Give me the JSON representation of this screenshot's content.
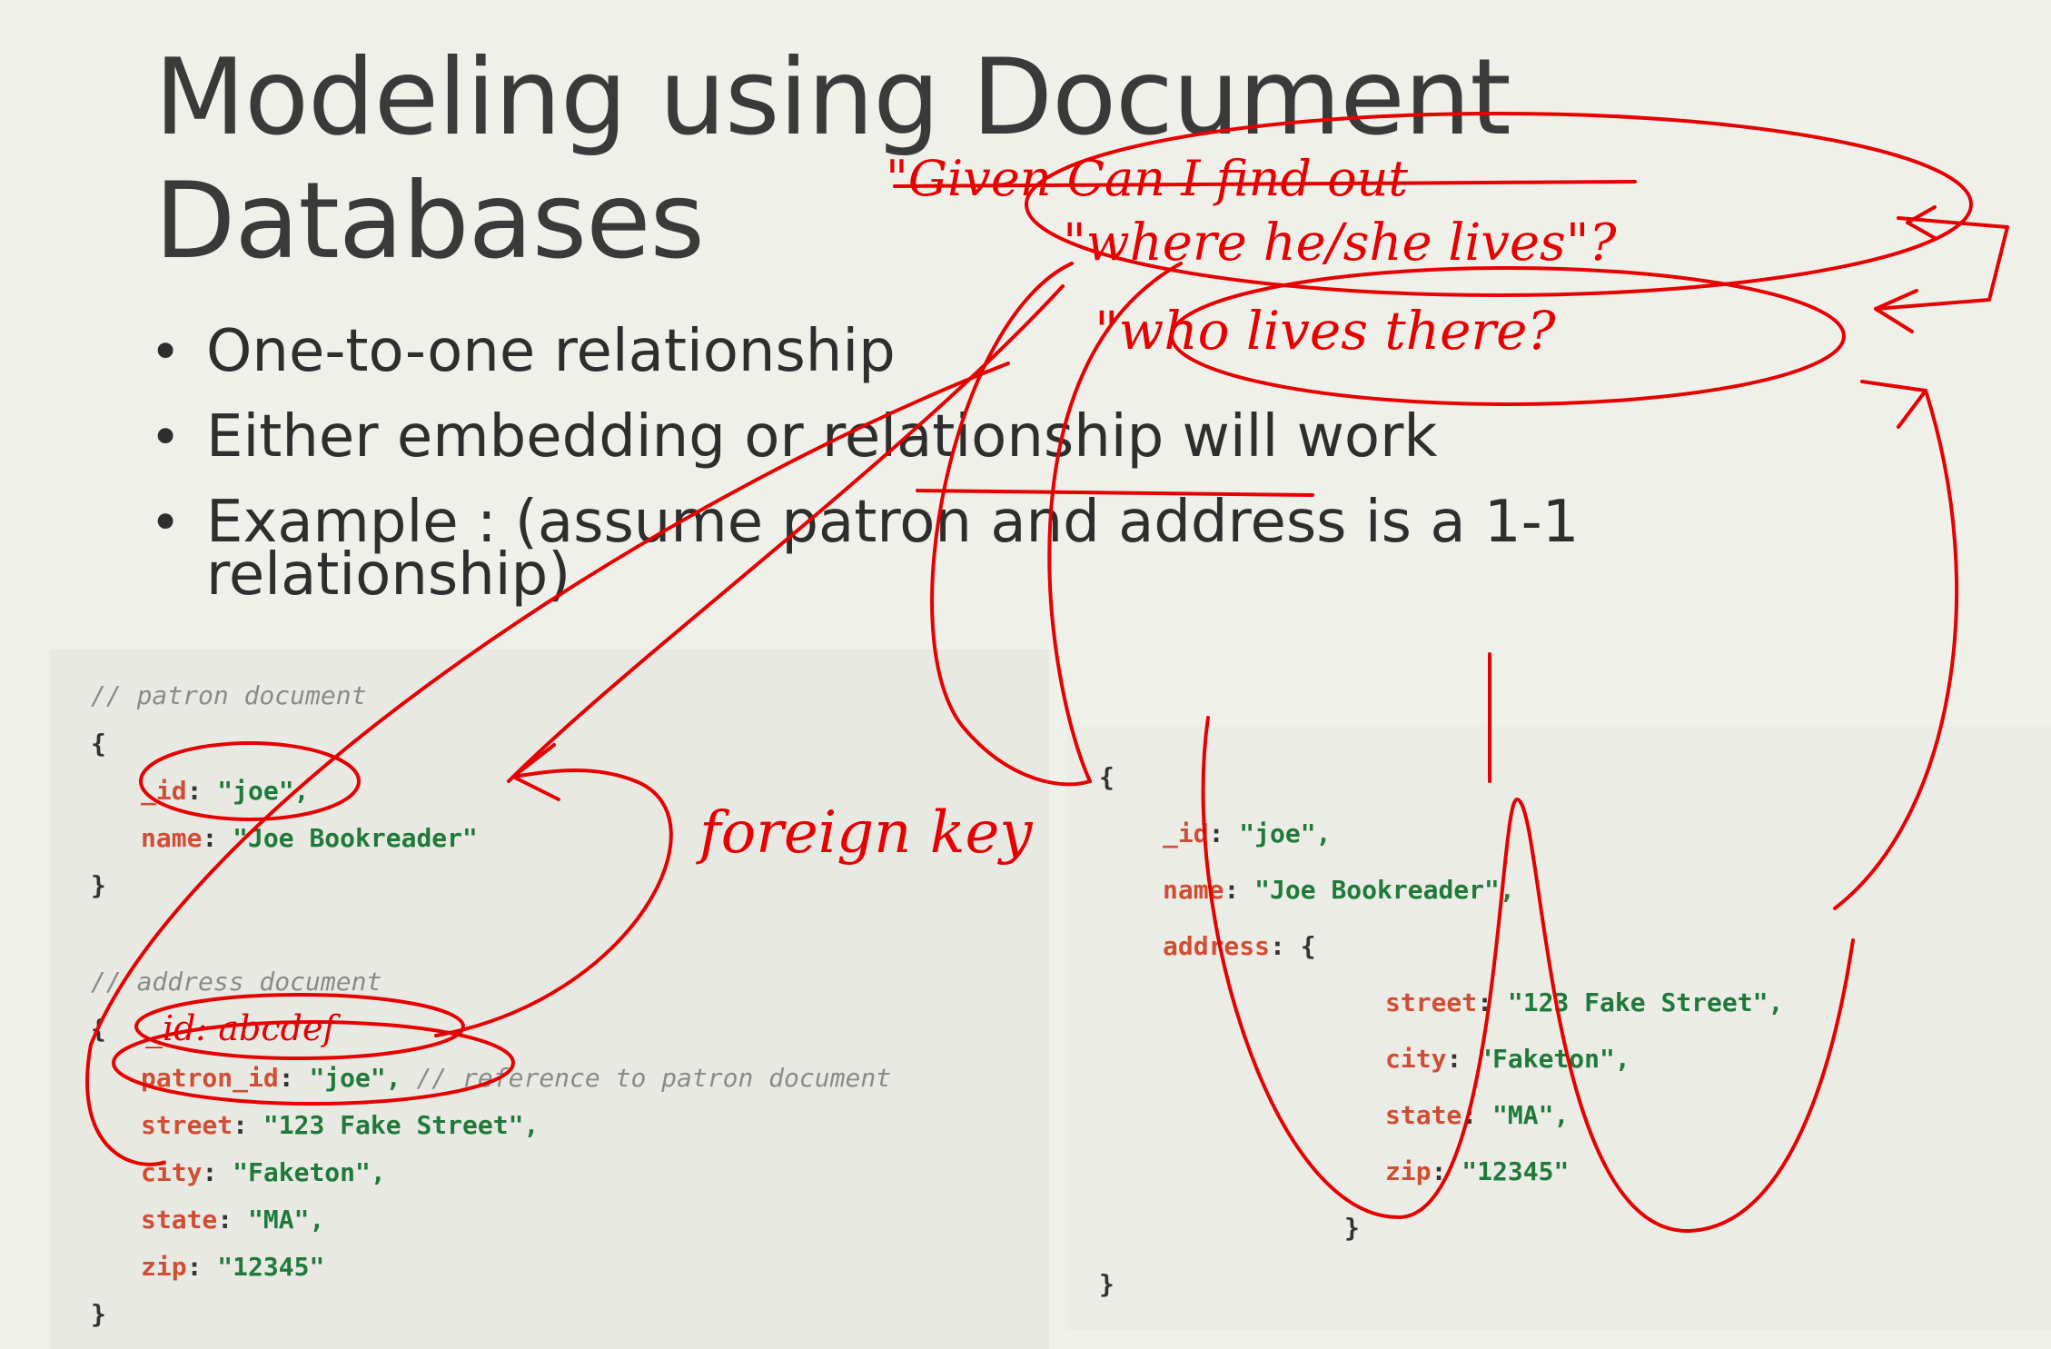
{
  "slide": {
    "title_line1": "Modeling using Document",
    "title_line2": "Databases",
    "bullets": [
      "One-to-one relationship",
      "Either embedding or relationship will work",
      "Example : (assume patron and address is a 1-1",
      "relationship)"
    ]
  },
  "left_code": {
    "comment_patron": "// patron document",
    "open1": "{",
    "id_key": "_id",
    "id_val": "\"joe\",",
    "name_key": "name",
    "name_val": "\"Joe Bookreader\"",
    "close1": "}",
    "comment_address": "// address document",
    "open2": "{",
    "patron_id_key": "patron_id",
    "patron_id_val": "\"joe\",",
    "patron_id_comment": "// reference to patron document",
    "street_key": "street",
    "street_val": "\"123 Fake Street\",",
    "city_key": "city",
    "city_val": "\"Faketon\",",
    "state_key": "state",
    "state_val": "\"MA\",",
    "zip_key": "zip",
    "zip_val": "\"12345\"",
    "close2": "}"
  },
  "right_code": {
    "open": "{",
    "id_key": "_id",
    "id_val": "\"joe\",",
    "name_key": "name",
    "name_val": "\"Joe Bookreader\",",
    "address_key": "address",
    "address_open": "{",
    "street_key": "street",
    "street_val": "\"123 Fake Street\",",
    "city_key": "city",
    "city_val": "\"Faketon\",",
    "state_key": "state",
    "state_val": "\"MA\",",
    "zip_key": "zip",
    "zip_val": "\"12345\"",
    "inner_close": "}",
    "close": "}"
  },
  "annotations": {
    "q1": "\"Given Can I find out",
    "q2": "\"where he/she lives\"?",
    "q3": "\"who lives there?",
    "foreign_key": "foreign key",
    "id_abbrev": "_id: abcdef"
  },
  "colors": {
    "ink": "#e60000",
    "key": "#d14e34",
    "string": "#1f7a3a",
    "comment": "#8a8a8a"
  }
}
